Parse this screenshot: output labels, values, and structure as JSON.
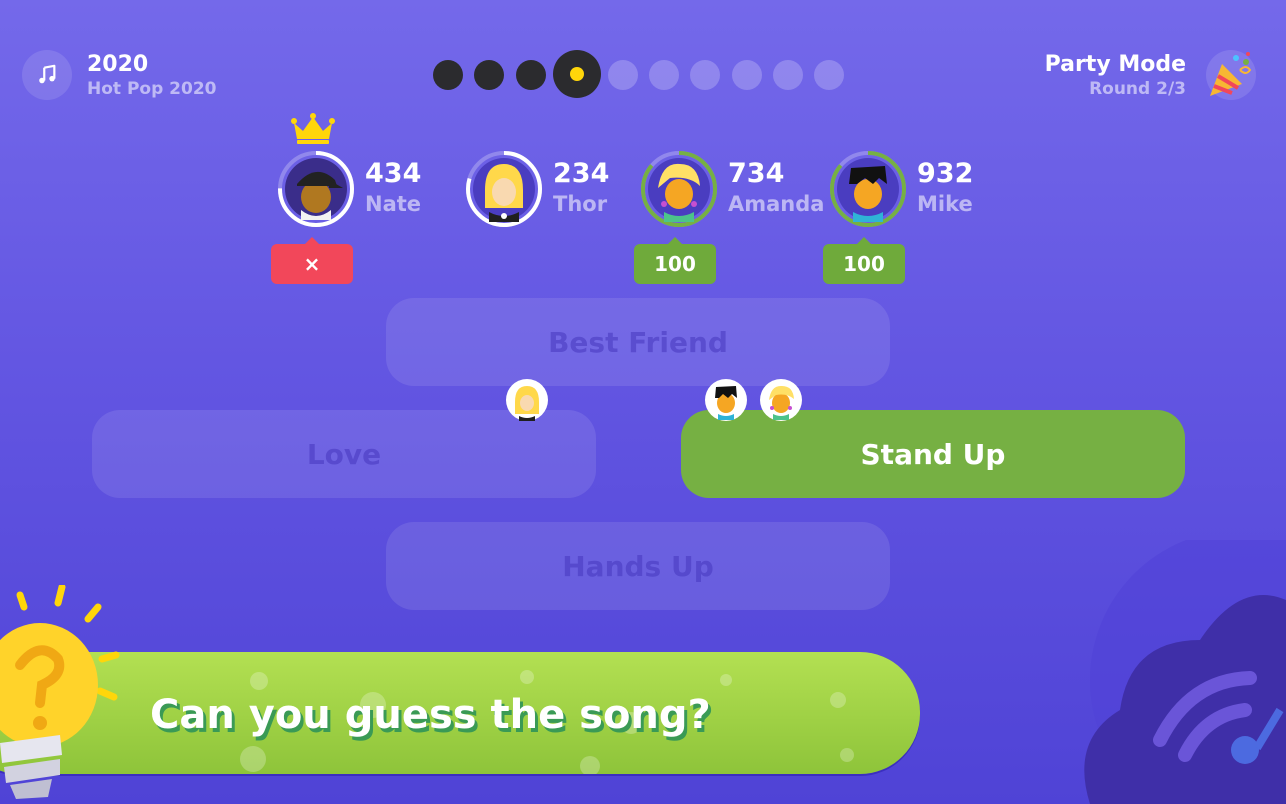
{
  "header": {
    "music_icon": "music-note-icon",
    "album_year": "2020",
    "album_name": "Hot Pop 2020",
    "mode_title": "Party Mode",
    "mode_round": "Round 2/3",
    "party_icon": "party-popper-icon"
  },
  "progress": {
    "total": 10,
    "completed": 3,
    "current": 4
  },
  "players": [
    {
      "name": "Nate",
      "score": "434",
      "result": "×",
      "result_type": "wrong",
      "leader": true,
      "ring_progress": 0.75,
      "ring_color": "#ffffff"
    },
    {
      "name": "Thor",
      "score": "234",
      "result": "",
      "result_type": "none",
      "leader": false,
      "ring_progress": 0.8,
      "ring_color": "#ffffff"
    },
    {
      "name": "Amanda",
      "score": "734",
      "result": "100",
      "result_type": "right",
      "leader": false,
      "ring_progress": 0.85,
      "ring_color": "#76b043"
    },
    {
      "name": "Mike",
      "score": "932",
      "result": "100",
      "result_type": "right",
      "leader": false,
      "ring_progress": 0.85,
      "ring_color": "#76b043"
    }
  ],
  "answers": {
    "best_friend": "Best Friend",
    "love": "Love",
    "stand_up": "Stand Up",
    "hands_up": "Hands Up"
  },
  "prompt": "Can you guess the song?",
  "colors": {
    "correct": "#76b043",
    "wrong": "#f2475a",
    "current_dot": "#ffd60a",
    "background": "#6356e2"
  }
}
